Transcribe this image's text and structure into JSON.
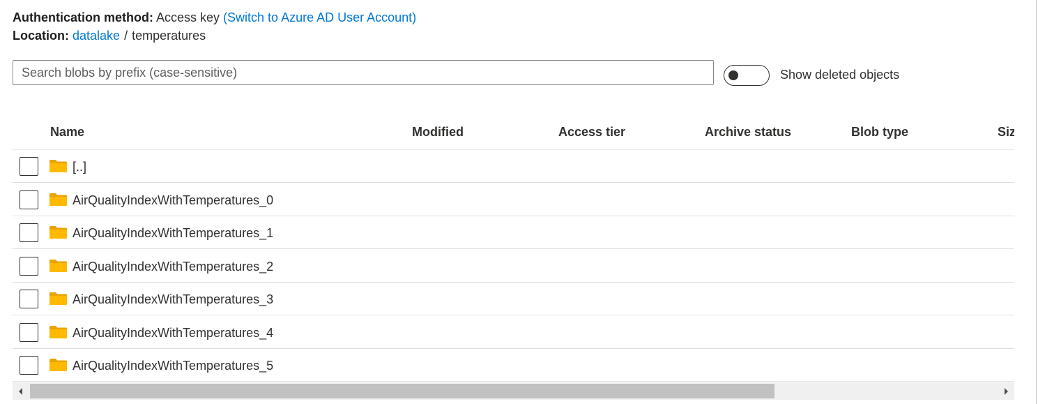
{
  "auth": {
    "label": "Authentication method:",
    "value": "Access key",
    "switch_link": "(Switch to Azure AD User Account)"
  },
  "location": {
    "label": "Location:",
    "container": "datalake",
    "separator": "/",
    "folder": "temperatures"
  },
  "search": {
    "placeholder": "Search blobs by prefix (case-sensitive)",
    "value": ""
  },
  "deleted_toggle": {
    "label": "Show deleted objects",
    "on": false
  },
  "table": {
    "columns": [
      "Name",
      "Modified",
      "Access tier",
      "Archive status",
      "Blob type",
      "Siz"
    ],
    "rows": [
      {
        "name": "[..]",
        "icon": "folder-icon"
      },
      {
        "name": "AirQualityIndexWithTemperatures_0",
        "icon": "folder-icon"
      },
      {
        "name": "AirQualityIndexWithTemperatures_1",
        "icon": "folder-icon"
      },
      {
        "name": "AirQualityIndexWithTemperatures_2",
        "icon": "folder-icon"
      },
      {
        "name": "AirQualityIndexWithTemperatures_3",
        "icon": "folder-icon"
      },
      {
        "name": "AirQualityIndexWithTemperatures_4",
        "icon": "folder-icon"
      },
      {
        "name": "AirQualityIndexWithTemperatures_5",
        "icon": "folder-icon"
      }
    ]
  },
  "colors": {
    "link": "#0078d4",
    "folder": "#ffb900",
    "folder_tab": "#eaa300",
    "text": "#323130",
    "divider": "#e1dfdd"
  }
}
